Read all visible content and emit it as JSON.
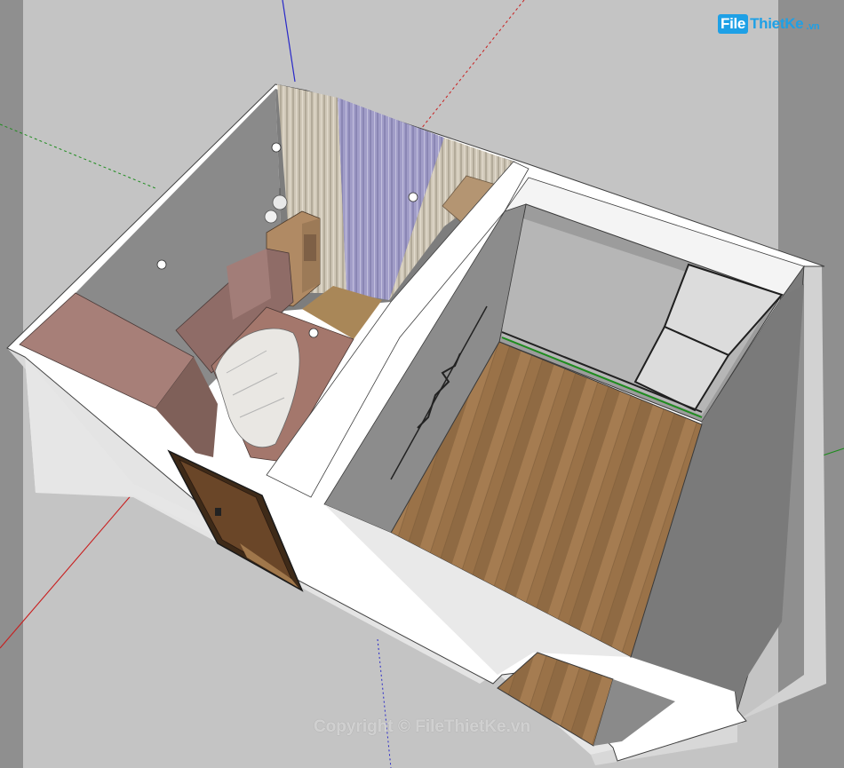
{
  "logo": {
    "boxed": "File",
    "text": "ThietKe",
    "suffix": ".vn"
  },
  "watermark": "Copyright © FileThietKe.vn",
  "colors": {
    "background": "#c4c4c4",
    "side_bands": "#8f8f8f",
    "wall_top": "#ffffff",
    "interior_wall": "#7a7a7a",
    "floor_wood": "#9a7248",
    "bed_cover": "#a4776c",
    "curtain_blue": "#9c98c2",
    "curtain_beige": "#c8c0b0",
    "door_wood": "#5b3a22",
    "axis_red": "#c81e1e",
    "axis_green": "#1e8c1e",
    "axis_blue": "#2828c8",
    "logo_blue": "#1ea0e6"
  }
}
